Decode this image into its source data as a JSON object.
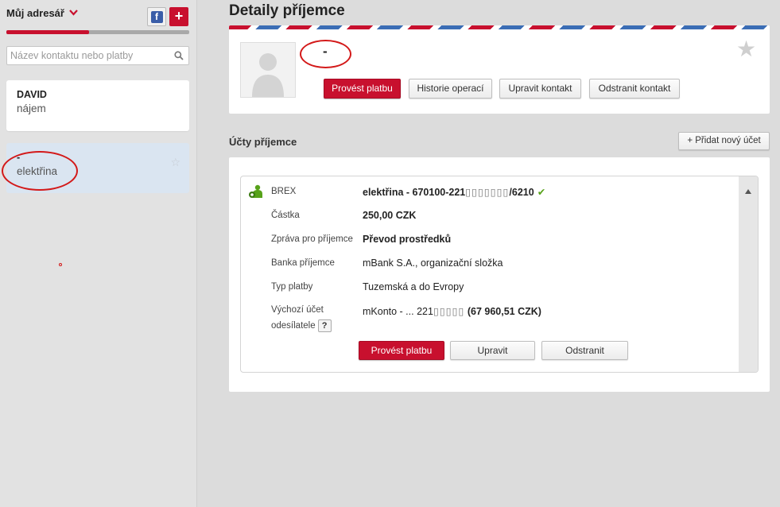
{
  "sidebar": {
    "title": "Můj adresář",
    "facebook_label": "f",
    "add_label": "+",
    "progress": 0.45,
    "search_placeholder": "Název kontaktu nebo platby",
    "contacts": [
      {
        "name": "DAVID",
        "subtitle": "nájem"
      },
      {
        "name": "-",
        "subtitle": "elektřina",
        "favorite": "☆"
      }
    ]
  },
  "main": {
    "title": "Detaily příjemce",
    "recipient": {
      "name": "-",
      "favorite": "★",
      "buttons": {
        "pay": "Provést platbu",
        "history": "Historie operací",
        "edit": "Upravit kontakt",
        "delete": "Odstranit kontakt"
      }
    },
    "accounts": {
      "title": "Účty příjemce",
      "add_button": "+ Přidat nový účet",
      "items": [
        {
          "bank_short": "BREX",
          "account_name": "elektřina",
          "account_number": " - 670100-221",
          "account_number_suffix": "/6210",
          "verified": "✔",
          "rows": [
            {
              "label": "Částka",
              "value": "250,00 CZK"
            },
            {
              "label": "Zpráva pro příjemce",
              "value": "Převod prostředků"
            },
            {
              "label": "Banka příjemce",
              "value": "mBank S.A., organizační složka"
            },
            {
              "label": "Typ platby",
              "value": "Tuzemská a do Evropy"
            }
          ],
          "source_label_1": "Výchozí účet",
          "source_label_2": "odesílatele",
          "source_help": "?",
          "source_value": "mKonto - ... 221",
          "source_balance": "(67 960,51 CZK)",
          "buttons": {
            "pay": "Provést platbu",
            "edit": "Upravit",
            "delete": "Odstranit"
          }
        }
      ]
    }
  },
  "colors": {
    "brand_red": "#c8102e",
    "selected_bg": "#dae5f1",
    "check_green": "#57a21a"
  }
}
